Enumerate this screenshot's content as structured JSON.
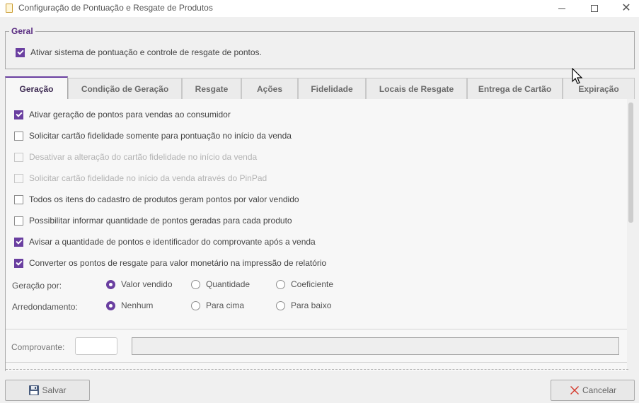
{
  "window": {
    "title": "Configuração de Pontuação e Resgate de Produtos"
  },
  "geral": {
    "legend": "Geral",
    "checkbox": {
      "label": "Ativar sistema de pontuação e controle de resgate de pontos.",
      "checked": true
    }
  },
  "tabs": [
    {
      "label": "Geração",
      "active": true
    },
    {
      "label": "Condição de Geração",
      "active": false
    },
    {
      "label": "Resgate",
      "active": false
    },
    {
      "label": "Ações",
      "active": false
    },
    {
      "label": "Fidelidade",
      "active": false
    },
    {
      "label": "Locais de Resgate",
      "active": false
    },
    {
      "label": "Entrega de Cartão",
      "active": false
    },
    {
      "label": "Expiração",
      "active": false
    }
  ],
  "options": [
    {
      "label": "Ativar geração de pontos para vendas ao consumidor",
      "checked": true,
      "enabled": true
    },
    {
      "label": "Solicitar cartão fidelidade somente para pontuação no início da venda",
      "checked": false,
      "enabled": true
    },
    {
      "label": "Desativar a alteração do cartão fidelidade no início da venda",
      "checked": false,
      "enabled": false
    },
    {
      "label": "Solicitar cartão fidelidade no início da venda através do PinPad",
      "checked": false,
      "enabled": false
    },
    {
      "label": "Todos os itens do cadastro de produtos geram pontos por valor vendido",
      "checked": false,
      "enabled": true
    },
    {
      "label": "Possibilitar informar quantidade de pontos geradas para cada produto",
      "checked": false,
      "enabled": true
    },
    {
      "label": "Avisar a quantidade de pontos e identificador do comprovante após a venda",
      "checked": true,
      "enabled": true
    },
    {
      "label": "Converter os pontos de resgate para valor monetário na impressão de relatório",
      "checked": true,
      "enabled": true
    }
  ],
  "geracao_por": {
    "label": "Geração por:",
    "options": [
      "Valor vendido",
      "Quantidade",
      "Coeficiente"
    ],
    "selected": "Valor vendido"
  },
  "arredondamento": {
    "label": "Arredondamento:",
    "options": [
      "Nenhum",
      "Para cima",
      "Para baixo"
    ],
    "selected": "Nenhum"
  },
  "comprovante": {
    "label": "Comprovante:",
    "code_value": "",
    "description_value": ""
  },
  "buttons": {
    "save": "Salvar",
    "cancel": "Cancelar"
  },
  "colors": {
    "accent": "#6a3fa0",
    "legend": "#5a2d82"
  },
  "icons": {
    "save": "floppy-disk-icon",
    "cancel": "red-x-icon",
    "window_minimize": "minimize-icon",
    "window_maximize": "maximize-icon",
    "window_close": "close-icon"
  }
}
